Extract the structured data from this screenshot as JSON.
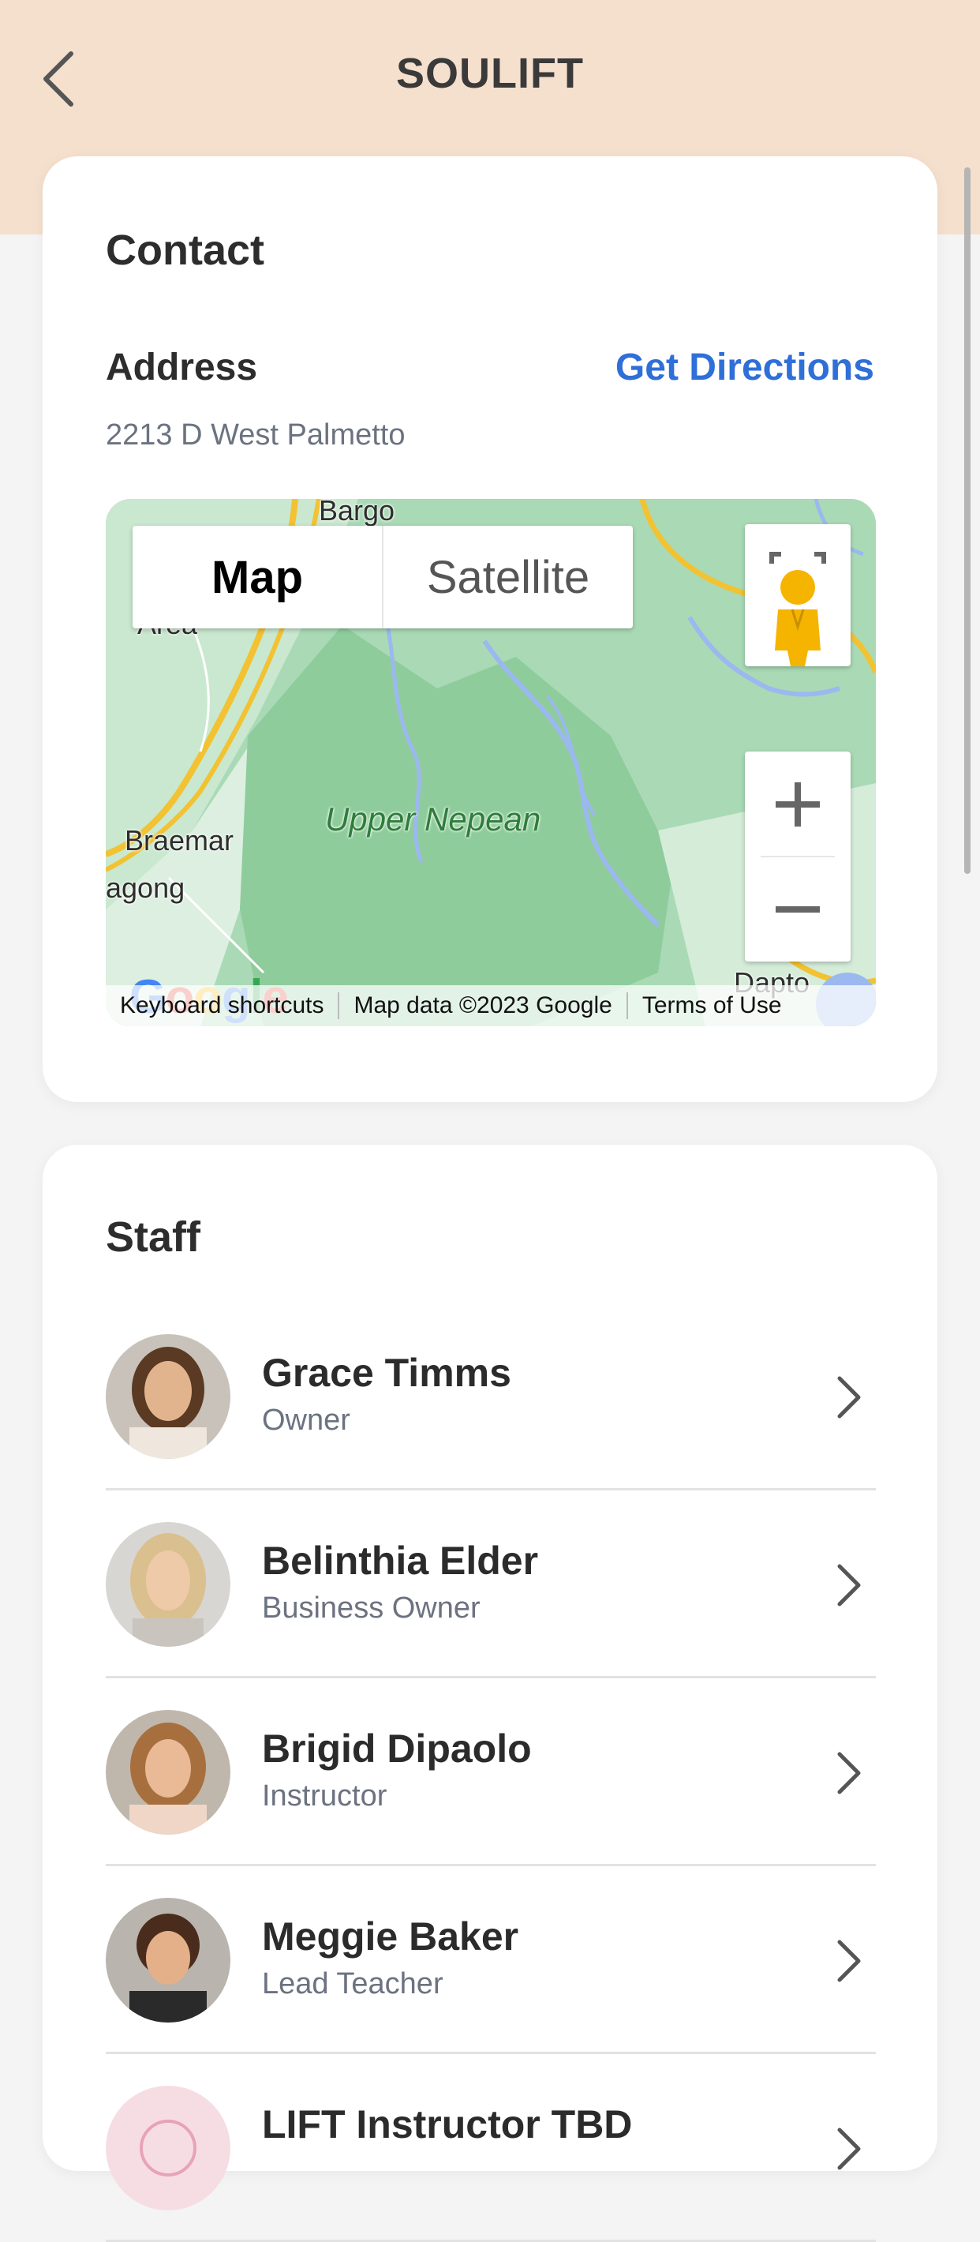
{
  "header": {
    "title": "SOULIFT",
    "back_icon": "chevron-left-icon",
    "background_color": "#f5dfcd"
  },
  "contact": {
    "title": "Contact",
    "address_label": "Address",
    "directions_label": "Get Directions",
    "address": "2213 D West Palmetto",
    "link_color": "#2f6fd8"
  },
  "map": {
    "type_map": "Map",
    "type_satellite": "Satellite",
    "labels": {
      "bargo": "Bargo",
      "area": "Area",
      "braemar": "Braemar",
      "agong": "agong",
      "upper_nepean": "Upper Nepean",
      "dapto": "Dapto"
    },
    "attribution": {
      "keyboard": "Keyboard shortcuts",
      "data": "Map data ©2023 Google",
      "terms": "Terms of Use"
    },
    "logo": "Google"
  },
  "staff": {
    "title": "Staff",
    "members": [
      {
        "name": "Grace Timms",
        "role": "Owner"
      },
      {
        "name": "Belinthia Elder",
        "role": "Business Owner"
      },
      {
        "name": "Brigid Dipaolo",
        "role": "Instructor"
      },
      {
        "name": "Meggie Baker",
        "role": "Lead Teacher"
      },
      {
        "name": "LIFT Instructor TBD",
        "role": ""
      }
    ]
  }
}
